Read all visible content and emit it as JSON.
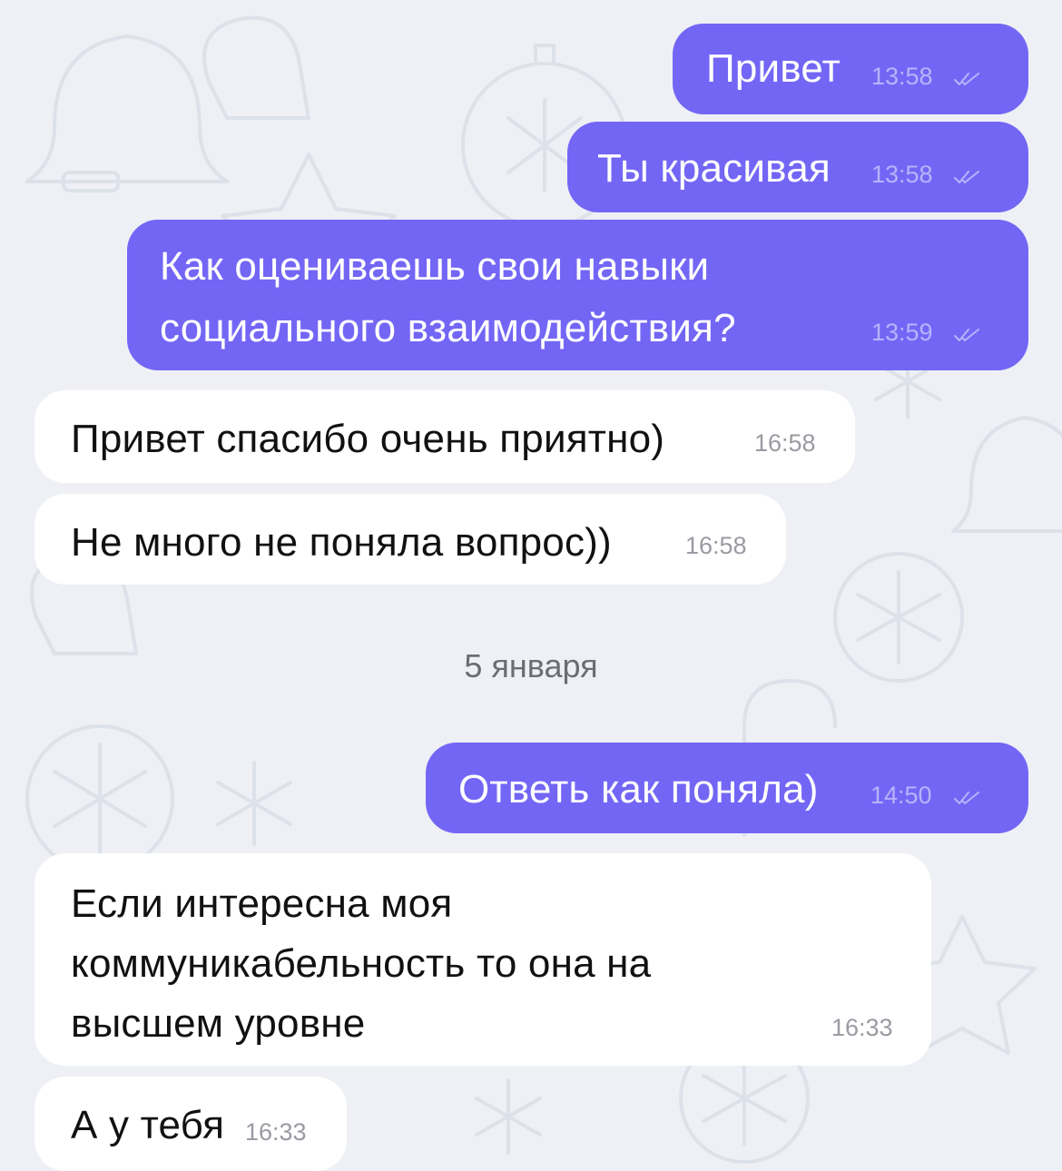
{
  "messages": [
    {
      "direction": "out",
      "text": "Привет",
      "time": "13:58",
      "status_icon": "double-check-icon"
    },
    {
      "direction": "out",
      "text": "Ты красивая",
      "time": "13:58",
      "status_icon": "double-check-icon"
    },
    {
      "direction": "out",
      "lines": [
        "Как оцениваешь свои навыки",
        "социального взаимодействия?"
      ],
      "time": "13:59",
      "status_icon": "double-check-icon"
    },
    {
      "direction": "in",
      "text": "Привет спасибо очень приятно)",
      "time": "16:58"
    },
    {
      "direction": "in",
      "text": "Не много не поняла вопрос))",
      "time": "16:58"
    },
    {
      "direction": "out",
      "text": "Ответь как поняла)",
      "time": "14:50",
      "status_icon": "double-check-icon"
    },
    {
      "direction": "in",
      "lines": [
        "Если интересна моя",
        "коммуникабельность то она на",
        "высшем уровне"
      ],
      "time": "16:33"
    },
    {
      "direction": "in",
      "text": "А у тебя",
      "time": "16:33"
    }
  ],
  "date_separator": "5 января",
  "colors": {
    "outgoing_bubble": "#7366f5",
    "incoming_bubble": "#ffffff",
    "background": "#eef0f5",
    "outgoing_meta": "#b9b3fb",
    "incoming_meta": "#9a9aa2"
  }
}
